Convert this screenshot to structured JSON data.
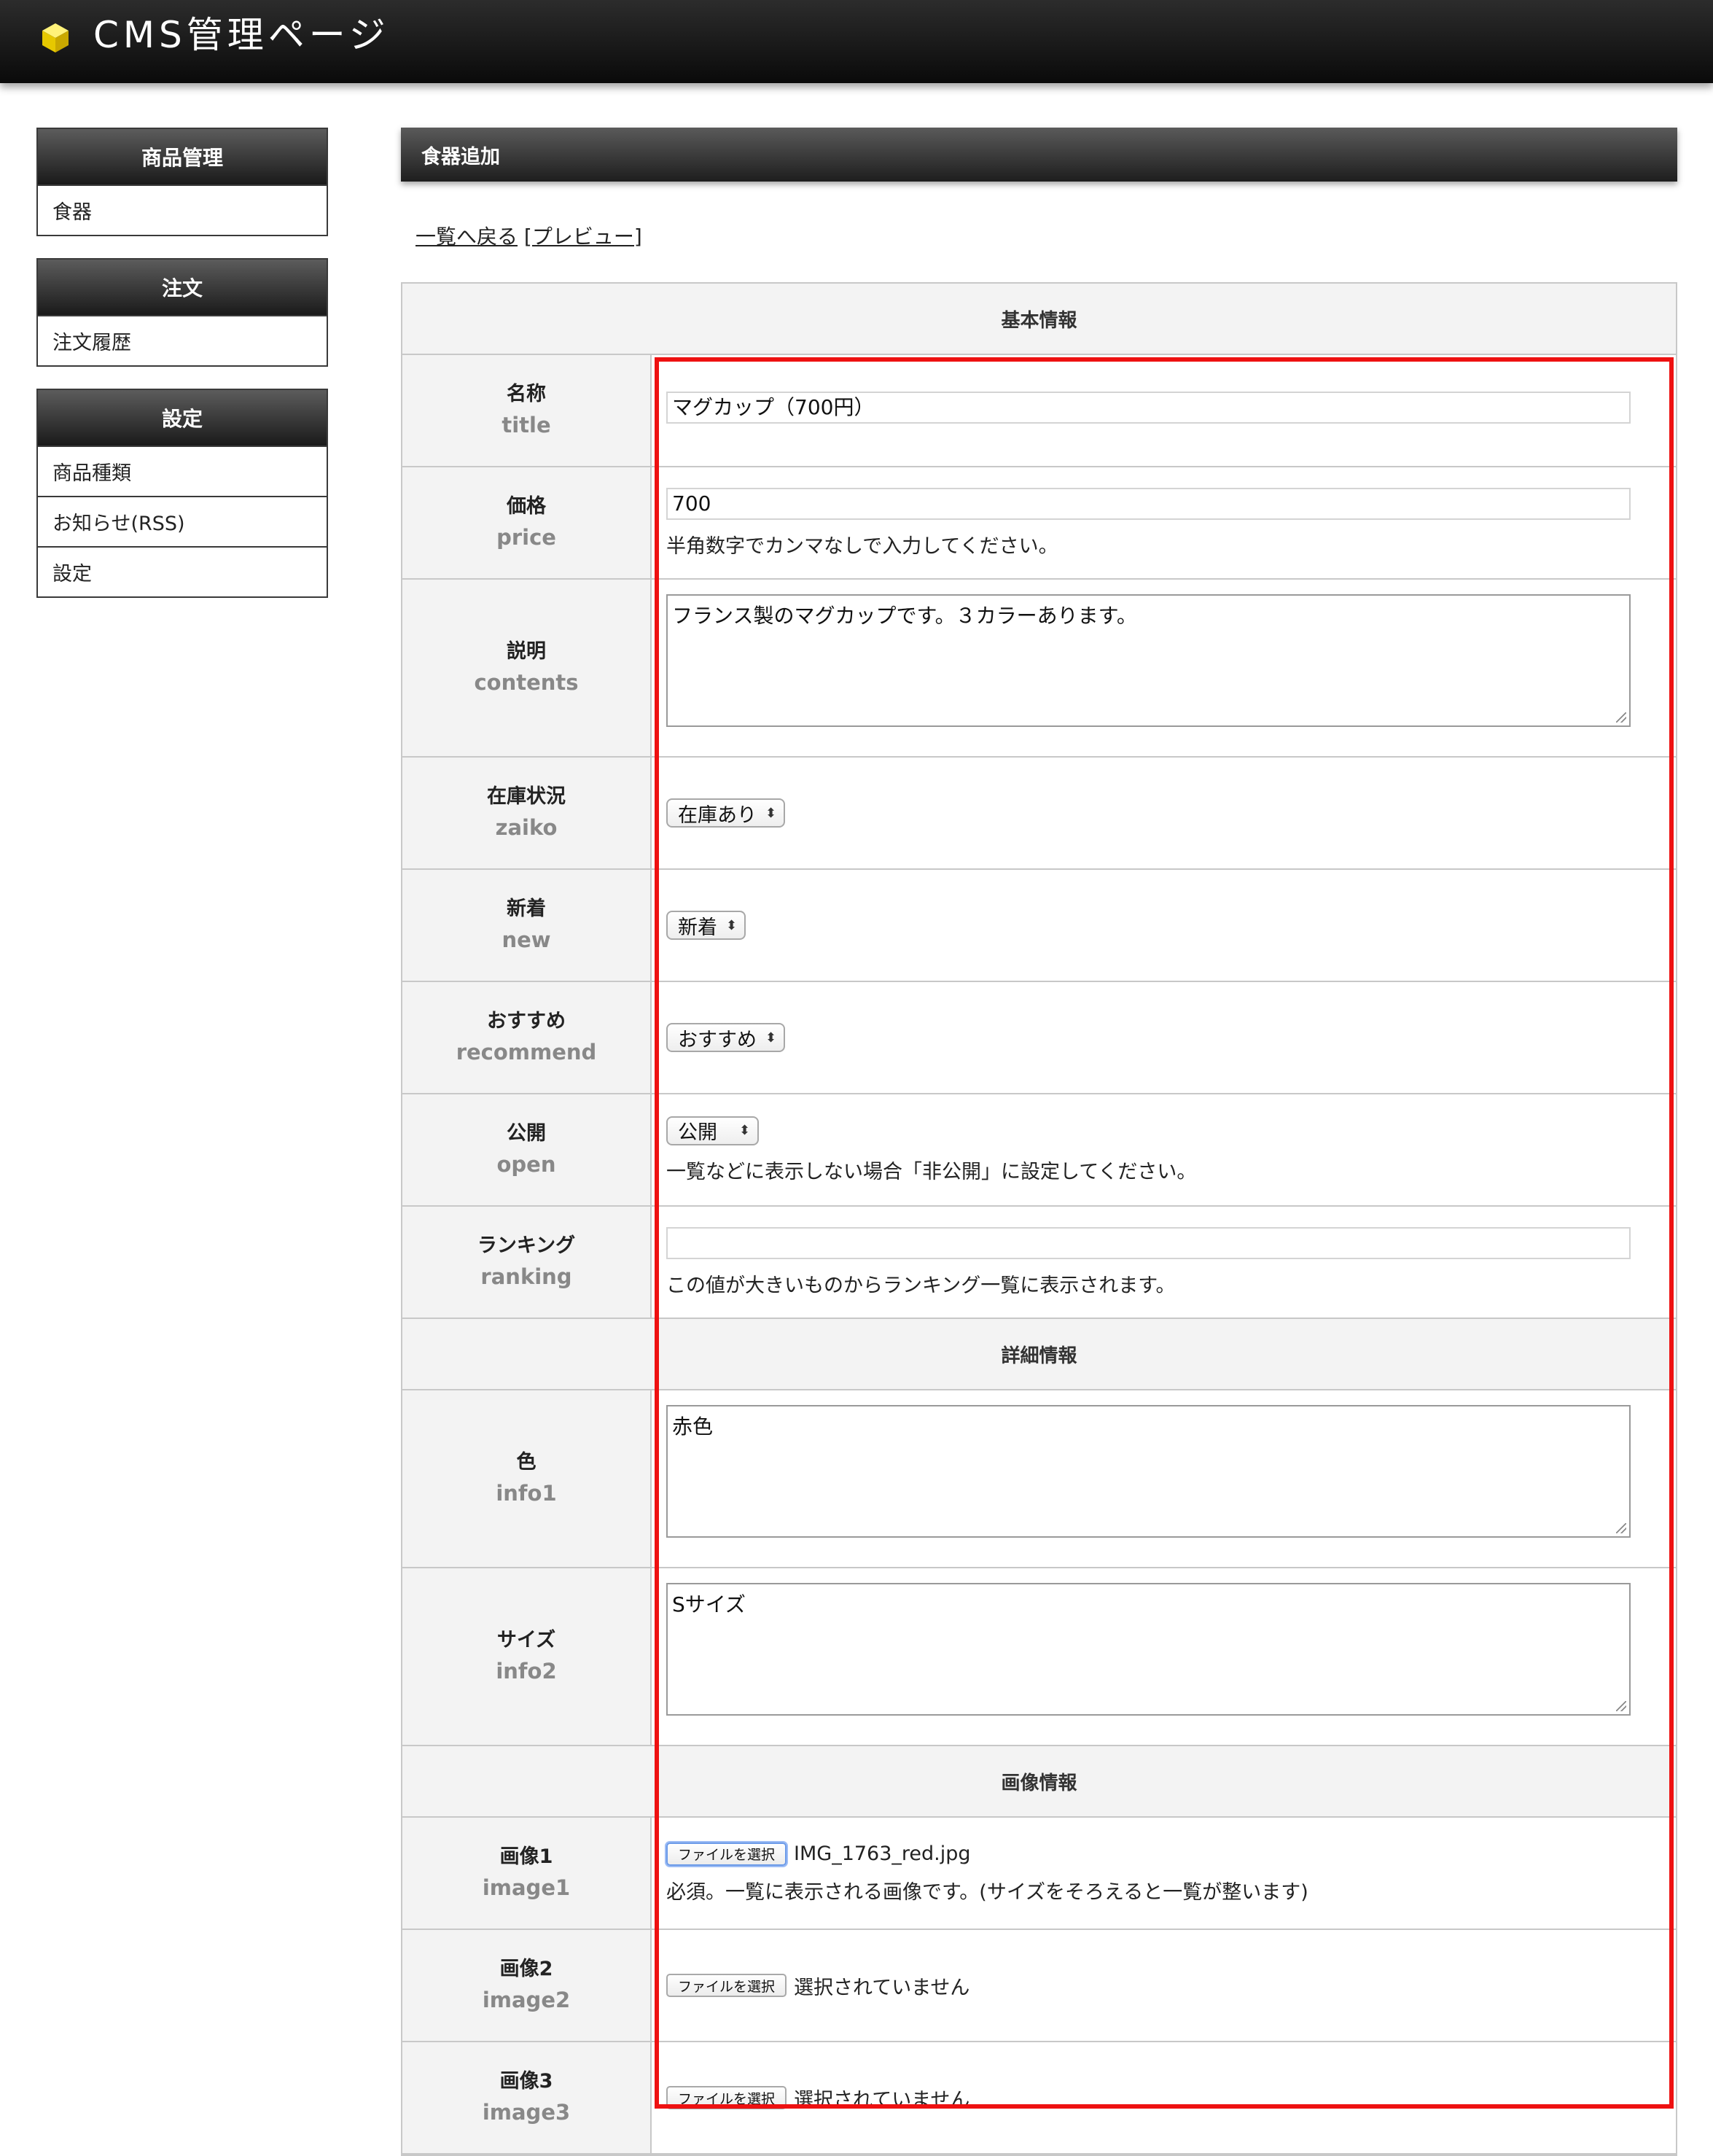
{
  "header": {
    "title": "CMS管理ページ",
    "logo_icon": "yellow-cube-icon"
  },
  "sidebar": {
    "groups": [
      {
        "title": "商品管理",
        "items": [
          {
            "label": "食器"
          }
        ]
      },
      {
        "title": "注文",
        "items": [
          {
            "label": "注文履歴"
          }
        ]
      },
      {
        "title": "設定",
        "items": [
          {
            "label": "商品種類"
          },
          {
            "label": "お知らせ(RSS)"
          },
          {
            "label": "設定"
          }
        ]
      }
    ]
  },
  "main": {
    "title": "食器追加",
    "back_link": "一覧へ戻る",
    "preview_link": "[プレビュー]",
    "sections": {
      "basic": "基本情報",
      "detail": "詳細情報",
      "image": "画像情報"
    },
    "fields": {
      "title": {
        "jp": "名称",
        "en": "title",
        "value": "マグカップ（700円）"
      },
      "price": {
        "jp": "価格",
        "en": "price",
        "value": "700",
        "help": "半角数字でカンマなしで入力してください。"
      },
      "contents": {
        "jp": "説明",
        "en": "contents",
        "value": "フランス製のマグカップです。３カラーあります。"
      },
      "zaiko": {
        "jp": "在庫状況",
        "en": "zaiko",
        "value": "在庫あり"
      },
      "new": {
        "jp": "新着",
        "en": "new",
        "value": "新着"
      },
      "recommend": {
        "jp": "おすすめ",
        "en": "recommend",
        "value": "おすすめ"
      },
      "open": {
        "jp": "公開",
        "en": "open",
        "value": "公開",
        "help": "一覧などに表示しない場合「非公開」に設定してください。"
      },
      "ranking": {
        "jp": "ランキング",
        "en": "ranking",
        "value": "",
        "help": "この値が大きいものからランキング一覧に表示されます。"
      },
      "info1": {
        "jp": "色",
        "en": "info1",
        "value": "赤色"
      },
      "info2": {
        "jp": "サイズ",
        "en": "info2",
        "value": "Sサイズ"
      },
      "image1": {
        "jp": "画像1",
        "en": "image1",
        "button": "ファイルを選択",
        "file": "IMG_1763_red.jpg",
        "help": "必須。一覧に表示される画像です。(サイズをそろえると一覧が整います)"
      },
      "image2": {
        "jp": "画像2",
        "en": "image2",
        "button": "ファイルを選択",
        "file": "選択されていません"
      },
      "image3": {
        "jp": "画像3",
        "en": "image3",
        "button": "ファイルを選択",
        "file": "選択されていません"
      }
    }
  },
  "colors": {
    "highlight_border": "#ee1111",
    "header_bg": "#111111",
    "logo": "#f2d600"
  }
}
